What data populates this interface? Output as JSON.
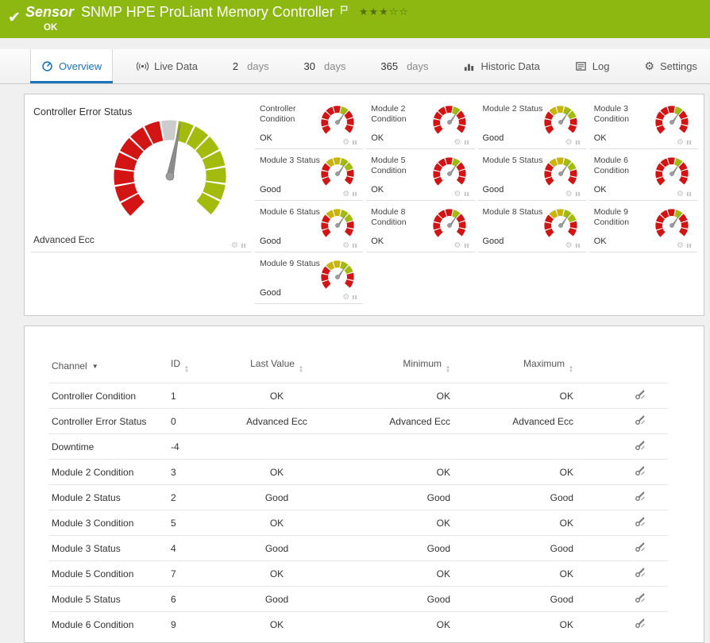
{
  "header": {
    "kind_label": "Sensor",
    "title": "SNMP HPE ProLiant Memory Controller",
    "status": "OK",
    "stars_filled": "★★★",
    "stars_empty": "☆☆"
  },
  "tabs": {
    "overview": "Overview",
    "live_data": "Live Data",
    "d2": {
      "number": "2",
      "unit": "days"
    },
    "d30": {
      "number": "30",
      "unit": "days"
    },
    "d365": {
      "number": "365",
      "unit": "days"
    },
    "historic": "Historic Data",
    "log": "Log",
    "settings": "Settings"
  },
  "gauges": {
    "big": {
      "title": "Controller Error Status",
      "value": "Advanced Ecc"
    },
    "tiles": [
      {
        "title": "Controller Condition",
        "value": "OK",
        "type": "condition"
      },
      {
        "title": "Module 2 Condition",
        "value": "OK",
        "type": "condition"
      },
      {
        "title": "Module 2 Status",
        "value": "Good",
        "type": "status"
      },
      {
        "title": "Module 3 Condition",
        "value": "OK",
        "type": "condition"
      },
      {
        "title": "Module 3 Status",
        "value": "Good",
        "type": "status"
      },
      {
        "title": "Module 5 Condition",
        "value": "OK",
        "type": "condition"
      },
      {
        "title": "Module 5 Status",
        "value": "Good",
        "type": "status"
      },
      {
        "title": "Module 6 Condition",
        "value": "OK",
        "type": "condition"
      },
      {
        "title": "Module 6 Status",
        "value": "Good",
        "type": "status"
      },
      {
        "title": "Module 8 Condition",
        "value": "OK",
        "type": "condition"
      },
      {
        "title": "Module 8 Status",
        "value": "Good",
        "type": "status"
      },
      {
        "title": "Module 9 Condition",
        "value": "OK",
        "type": "condition"
      },
      {
        "title": "Module 9 Status",
        "value": "Good",
        "type": "status"
      }
    ]
  },
  "table": {
    "headers": {
      "channel": "Channel",
      "id": "ID",
      "last_value": "Last Value",
      "minimum": "Minimum",
      "maximum": "Maximum"
    },
    "rows": [
      {
        "channel": "Controller Condition",
        "id": "1",
        "last_value": "OK",
        "minimum": "OK",
        "maximum": "OK"
      },
      {
        "channel": "Controller Error Status",
        "id": "0",
        "last_value": "Advanced Ecc",
        "minimum": "Advanced Ecc",
        "maximum": "Advanced Ecc"
      },
      {
        "channel": "Downtime",
        "id": "-4",
        "last_value": "",
        "minimum": "",
        "maximum": ""
      },
      {
        "channel": "Module 2 Condition",
        "id": "3",
        "last_value": "OK",
        "minimum": "OK",
        "maximum": "OK"
      },
      {
        "channel": "Module 2 Status",
        "id": "2",
        "last_value": "Good",
        "minimum": "Good",
        "maximum": "Good"
      },
      {
        "channel": "Module 3 Condition",
        "id": "5",
        "last_value": "OK",
        "minimum": "OK",
        "maximum": "OK"
      },
      {
        "channel": "Module 3 Status",
        "id": "4",
        "last_value": "Good",
        "minimum": "Good",
        "maximum": "Good"
      },
      {
        "channel": "Module 5 Condition",
        "id": "7",
        "last_value": "OK",
        "minimum": "OK",
        "maximum": "OK"
      },
      {
        "channel": "Module 5 Status",
        "id": "6",
        "last_value": "Good",
        "minimum": "Good",
        "maximum": "Good"
      },
      {
        "channel": "Module 6 Condition",
        "id": "9",
        "last_value": "OK",
        "minimum": "OK",
        "maximum": "OK"
      }
    ]
  },
  "colors": {
    "ok_green": "#8cb811",
    "accent_blue": "#1c74bb",
    "gauge_red": "#d21414",
    "gauge_green": "#a2bb0c",
    "gauge_yellow": "#c9b40d",
    "gauge_neutral": "#cccccc"
  }
}
